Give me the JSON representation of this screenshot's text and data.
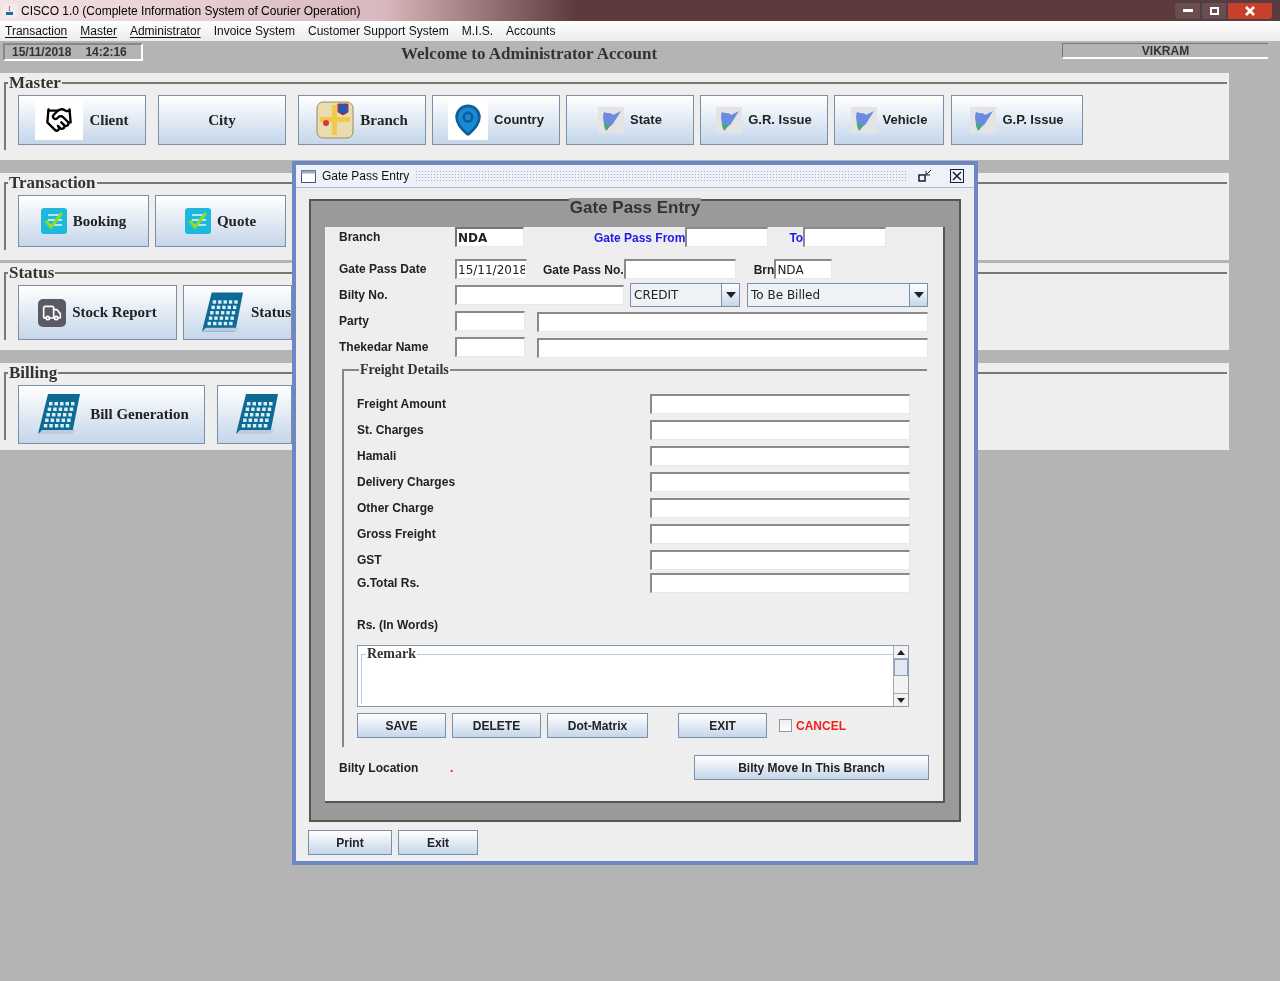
{
  "window": {
    "title": "CISCO 1.0 (Complete Information System of Courier Operation)"
  },
  "menu": [
    {
      "label": "Transaction",
      "mnemonic": true
    },
    {
      "label": "Master",
      "mnemonic": true
    },
    {
      "label": "Administrator",
      "mnemonic": true
    },
    {
      "label": "Invoice System",
      "mnemonic": false
    },
    {
      "label": "Customer Support System",
      "mnemonic": false
    },
    {
      "label": "M.I.S.",
      "mnemonic": false
    },
    {
      "label": "Accounts",
      "mnemonic": false
    }
  ],
  "status_strip": {
    "date": "15/11/2018",
    "time": "14:2:16",
    "welcome": "Welcome to Administrator Account",
    "user": "VIKRAM"
  },
  "sections": [
    {
      "title": "Master",
      "buttons": [
        {
          "label": "Client",
          "kind": "handshake"
        },
        {
          "label": "City",
          "kind": "plain"
        },
        {
          "label": "Branch",
          "kind": "map"
        },
        {
          "label": "Country",
          "kind": "pin"
        },
        {
          "label": "State",
          "kind": "region"
        },
        {
          "label": "G.R. Issue",
          "kind": "region"
        },
        {
          "label": "Vehicle",
          "kind": "region"
        },
        {
          "label": "G.P. Issue",
          "kind": "region"
        }
      ]
    },
    {
      "title": "Transaction",
      "buttons": [
        {
          "label": "Booking",
          "kind": "checklist"
        },
        {
          "label": "Quote",
          "kind": "checklist"
        }
      ]
    },
    {
      "title": "Status",
      "buttons": [
        {
          "label": "Stock Report",
          "kind": "truck"
        },
        {
          "label": "Status",
          "kind": "calendar"
        }
      ]
    },
    {
      "title": "Billing",
      "buttons": [
        {
          "label": "Bill Generation",
          "kind": "calendar"
        },
        {
          "kind": "calendar"
        }
      ]
    }
  ],
  "dialog": {
    "title": "Gate Pass Entry",
    "heading": "Gate Pass Entry",
    "branch": {
      "label": "Branch",
      "value": "NDA"
    },
    "gate_pass_from": {
      "label": "Gate Pass From"
    },
    "to": {
      "label": "To"
    },
    "gate_pass_date": {
      "label": "Gate Pass Date",
      "value": "15/11/2018"
    },
    "gate_pass_no": {
      "label": "Gate Pass No."
    },
    "brn": {
      "label": "Brn",
      "value": "NDA"
    },
    "bilty_no": {
      "label": "Bilty No."
    },
    "payment_type": {
      "value": "CREDIT"
    },
    "billing_status": {
      "value": "To Be Billed"
    },
    "party": {
      "label": "Party"
    },
    "thekedar_name": {
      "label": "Thekedar Name"
    },
    "freight": {
      "title": "Freight Details",
      "rows": [
        {
          "label": "Freight Amount"
        },
        {
          "label": "St. Charges"
        },
        {
          "label": "Hamali"
        },
        {
          "label": "Delivery Charges"
        },
        {
          "label": "Other Charge"
        },
        {
          "label": "Gross Freight"
        },
        {
          "label": "GST"
        },
        {
          "label": "G.Total Rs."
        }
      ],
      "in_words_label": "Rs. (In Words)",
      "remark": {
        "label": "Remark"
      },
      "buttons": [
        "SAVE",
        "DELETE",
        "Dot-Matrix",
        "EXIT"
      ],
      "cancel": {
        "label": "CANCEL",
        "checked": false
      }
    },
    "bilty_location": {
      "label": "Bilty Location",
      "value": "."
    },
    "bilty_move_button": "Bilty Move In This Branch",
    "footer_buttons": [
      "Print",
      "Exit"
    ]
  }
}
